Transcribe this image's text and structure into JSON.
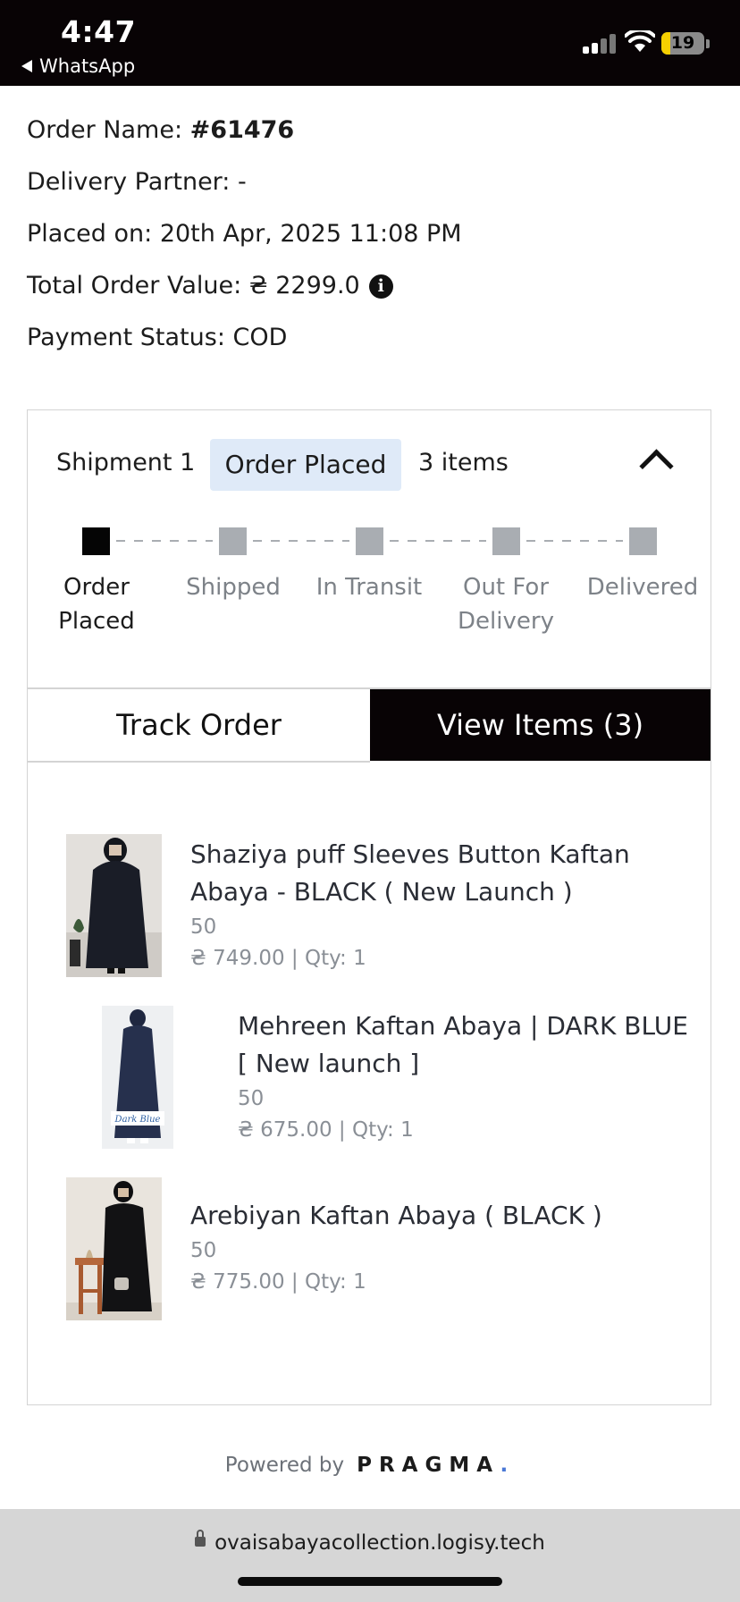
{
  "status_bar": {
    "time": "4:47",
    "back_app": "WhatsApp",
    "battery": "19"
  },
  "order": {
    "name_label": "Order Name: ",
    "name_value": "#61476",
    "partner": "Delivery Partner: -",
    "placed_on": "Placed on: 20th Apr, 2025 11:08 PM",
    "total": "Total Order Value: ₴ 2299.0",
    "payment": "Payment Status: COD"
  },
  "shipment": {
    "label": "Shipment 1",
    "status_badge": "Order Placed",
    "item_count": "3 items",
    "steps": [
      {
        "line1": "Order",
        "line2": "Placed",
        "done": true
      },
      {
        "line1": "Shipped",
        "line2": "",
        "done": false
      },
      {
        "line1": "In Transit",
        "line2": "",
        "done": false
      },
      {
        "line1": "Out For",
        "line2": "Delivery",
        "done": false
      },
      {
        "line1": "Delivered",
        "line2": "",
        "done": false
      }
    ],
    "tabs": {
      "track": "Track Order",
      "items": "View Items (3)"
    }
  },
  "items": [
    {
      "title": "Shaziya puff Sleeves Button Kaftan Abaya - BLACK ( New Launch )",
      "variant": "50",
      "price_qty": "₴ 749.00 | Qty: 1"
    },
    {
      "title": "Mehreen Kaftan Abaya | DARK BLUE [ New launch ]",
      "variant": "50",
      "price_qty": "₴ 675.00 | Qty: 1",
      "image_caption": "Dark Blue"
    },
    {
      "title": "Arebiyan Kaftan Abaya ( BLACK )",
      "variant": "50",
      "price_qty": "₴ 775.00 | Qty: 1"
    }
  ],
  "footer": {
    "powered_by": "Powered by",
    "brand": "PRAGMA",
    "brand_dot": "."
  },
  "browser": {
    "url": "ovaisabayacollection.logisy.tech"
  },
  "colors": {
    "accent_dark": "#080305",
    "badge_bg": "#dfeaf8",
    "pending_step": "#a9adb2",
    "brand_dot": "#4a78d6"
  }
}
